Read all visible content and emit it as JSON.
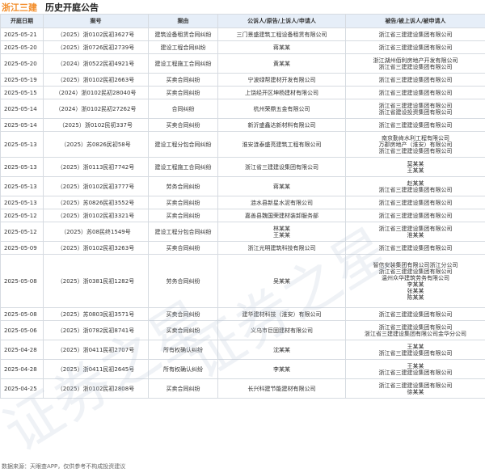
{
  "header": {
    "company": "浙江三建",
    "title": "历史开庭公告"
  },
  "columns": [
    "开庭日期",
    "案号",
    "案由",
    "公诉人/原告/上诉人/申请人",
    "被告/被上诉人/被申请人"
  ],
  "rows": [
    {
      "date": "2025-05-21",
      "case_no": "（2025）浙0102民初3627号",
      "cause": "建筑设备租赁合同纠纷",
      "plaintiff": [
        "三门景盛建筑工程设备租赁有限公司"
      ],
      "defendant": [
        "浙江省三建建设集团有限公司"
      ]
    },
    {
      "date": "2025-05-20",
      "case_no": "（2025）浙0726民初2739号",
      "cause": "建设工程合同纠纷",
      "plaintiff": [
        "蒋某某"
      ],
      "defendant": [
        "浙江省三建建设集团有限公司"
      ]
    },
    {
      "date": "2025-05-20",
      "case_no": "（2024）浙0522民初4921号",
      "cause": "建设工程施工合同纠纷",
      "plaintiff": [
        "黄某某"
      ],
      "defendant": [
        "浙江湖州佰利房地产开发有限公司",
        "浙江省三建建设集团有限公司"
      ]
    },
    {
      "date": "2025-05-19",
      "case_no": "（2025）浙0102民初2663号",
      "cause": "买卖合同纠纷",
      "plaintiff": [
        "宁波绿帮建材开发有限公司"
      ],
      "defendant": [
        "浙江省三建建设集团有限公司"
      ]
    },
    {
      "date": "2025-05-15",
      "case_no": "（2024）浙0102民初28040号",
      "cause": "买卖合同纠纷",
      "plaintiff": [
        "上饶经开区坤杨建材有限公司"
      ],
      "defendant": [
        "浙江省三建建设集团有限公司"
      ]
    },
    {
      "date": "2025-05-14",
      "case_no": "（2024）浙0102民初27262号",
      "cause": "合同纠纷",
      "plaintiff": [
        "杭州荣鼎五金有限公司"
      ],
      "defendant": [
        "浙江省三建建设集团有限公司",
        "浙江省建设投资集团有限公司"
      ]
    },
    {
      "date": "2025-05-14",
      "case_no": "（2025）浙0102民初337号",
      "cause": "买卖合同纠纷",
      "plaintiff": [
        "新沂盛鑫达新材料有限公司"
      ],
      "defendant": [
        "浙江省三建建设集团有限公司"
      ]
    },
    {
      "date": "2025-05-13",
      "case_no": "（2025）苏0826民初58号",
      "cause": "建设工程分包合同纠纷",
      "plaintiff": [
        "淮安涟泰盛亮建筑工程有限公司"
      ],
      "defendant": [
        "南京勤肯水利工程有限公司",
        "万郡房地产（淮安）有限公司",
        "浙江省三建建设集团有限公司"
      ]
    },
    {
      "date": "2025-05-13",
      "case_no": "（2025）浙0113民初7742号",
      "cause": "建设工程施工合同纠纷",
      "plaintiff": [
        "浙江省三建建设集团有限公司"
      ],
      "defendant": [
        "莫某某",
        "王某某"
      ]
    },
    {
      "date": "2025-05-13",
      "case_no": "（2025）浙0102民初3777号",
      "cause": "劳务合同纠纷",
      "plaintiff": [
        "蒋某某"
      ],
      "defendant": [
        "赵某某",
        "浙江省三建建设集团有限公司"
      ]
    },
    {
      "date": "2025-05-13",
      "case_no": "（2025）苏0826民初3552号",
      "cause": "买卖合同纠纷",
      "plaintiff": [
        "涟水县新星水泥有限公司"
      ],
      "defendant": [
        "浙江省三建建设集团有限公司"
      ]
    },
    {
      "date": "2025-05-12",
      "case_no": "（2025）浙0102民初3321号",
      "cause": "买卖合同纠纷",
      "plaintiff": [
        "嘉善县魏国荣建材装卸服务部"
      ],
      "defendant": [
        "浙江省三建建设集团有限公司"
      ]
    },
    {
      "date": "2025-05-12",
      "case_no": "（2025）苏08民终1549号",
      "cause": "建设工程分包合同纠纷",
      "plaintiff": [
        "林某某",
        "王某某"
      ],
      "defendant": [
        "浙江省三建建设集团有限公司",
        "淮某某"
      ]
    },
    {
      "date": "2025-05-09",
      "case_no": "（2025）浙0102民初3263号",
      "cause": "买卖合同纠纷",
      "plaintiff": [
        "浙江光明建筑科技有限公司"
      ],
      "defendant": [
        "浙江省三建建设集团有限公司"
      ]
    },
    {
      "date": "2025-05-08",
      "case_no": "（2025）浙0381民初1282号",
      "cause": "劳务合同纠纷",
      "plaintiff": [
        "吴某某"
      ],
      "defendant": [
        "智信安装集团有限公司浙江分公司",
        "浙江省三建建设集团有限公司",
        "温州众华建筑劳务有限公司",
        "李某某",
        "张某某",
        "陈某某"
      ]
    },
    {
      "date": "2025-05-08",
      "case_no": "（2025）苏0803民初3571号",
      "cause": "买卖合同纠纷",
      "plaintiff": [
        "建华建材科技（淮安）有限公司"
      ],
      "defendant": [
        "浙江省三建建设集团有限公司"
      ]
    },
    {
      "date": "2025-05-06",
      "case_no": "（2025）浙0782民初8741号",
      "cause": "买卖合同纠纷",
      "plaintiff": [
        "义乌市巨固建材有限公司"
      ],
      "defendant": [
        "浙江省三建建设集团有限公司",
        "浙江省三建建设集团有限公司金华分公司"
      ]
    },
    {
      "date": "2025-04-28",
      "case_no": "（2025）浙0411民初2707号",
      "cause": "所有权确认纠纷",
      "plaintiff": [
        "沈某某"
      ],
      "defendant": [
        "王某某",
        "浙江省三建建设集团有限公司"
      ]
    },
    {
      "date": "2025-04-28",
      "case_no": "（2025）浙0411民初2645号",
      "cause": "所有权确认纠纷",
      "plaintiff": [
        "李某某"
      ],
      "defendant": [
        "王某某",
        "浙江省三建建设集团有限公司"
      ]
    },
    {
      "date": "2025-04-25",
      "case_no": "（2025）浙0102民初2808号",
      "cause": "买卖合同纠纷",
      "plaintiff": [
        "长兴科建节能建材有限公司"
      ],
      "defendant": [
        "浙江省三建建设集团有限公司",
        "徐某某"
      ]
    }
  ],
  "footer": "数据来源：天眼查APP，仅供参考不构成投资建议",
  "watermark": "证券之星"
}
